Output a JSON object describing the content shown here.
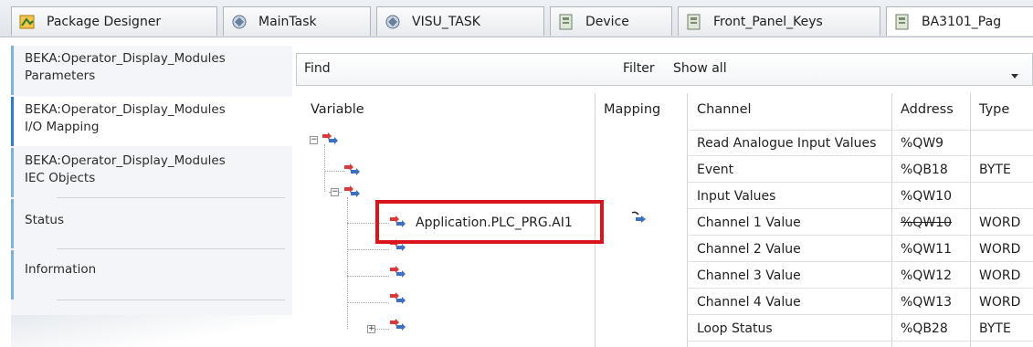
{
  "tabs": [
    {
      "label": "Package Designer",
      "icon": "package-icon"
    },
    {
      "label": "MainTask",
      "icon": "task-icon"
    },
    {
      "label": "VISU_TASK",
      "icon": "task-icon"
    },
    {
      "label": "Device",
      "icon": "device-icon"
    },
    {
      "label": "Front_Panel_Keys",
      "icon": "device-icon"
    },
    {
      "label": "BA3101_Pag",
      "icon": "device-icon"
    }
  ],
  "nav": {
    "items": [
      {
        "line1": "BEKA:Operator_Display_Modules",
        "line2": "Parameters"
      },
      {
        "line1": "BEKA:Operator_Display_Modules",
        "line2": "I/O Mapping"
      },
      {
        "line1": "BEKA:Operator_Display_Modules",
        "line2": "IEC Objects"
      },
      {
        "line1": "Status",
        "line2": ""
      },
      {
        "line1": "Information",
        "line2": ""
      }
    ],
    "active_index": 1
  },
  "findbar": {
    "find_label": "Find",
    "find_value": "",
    "filter_label": "Filter",
    "filter_value": "Show all"
  },
  "table": {
    "headers": {
      "variable": "Variable",
      "mapping": "Mapping",
      "channel": "Channel",
      "address": "Address",
      "type": "Type"
    },
    "rows": [
      {
        "variable": "",
        "channel": "Read Analogue Input Values",
        "address": "%QW9",
        "type": ""
      },
      {
        "variable": "",
        "channel": "Event",
        "address": "%QB18",
        "type": "BYTE"
      },
      {
        "variable": "",
        "channel": "Input Values",
        "address": "%QW10",
        "type": ""
      },
      {
        "variable": "Application.PLC_PRG.AI1",
        "channel": "Channel 1 Value",
        "address": "%QW10",
        "address_struck": true,
        "type": "WORD",
        "mapped": true
      },
      {
        "variable": "",
        "channel": "Channel 2 Value",
        "address": "%QW11",
        "type": "WORD"
      },
      {
        "variable": "",
        "channel": "Channel 3 Value",
        "address": "%QW12",
        "type": "WORD"
      },
      {
        "variable": "",
        "channel": "Channel 4 Value",
        "address": "%QW13",
        "type": "WORD"
      },
      {
        "variable": "",
        "channel": "Loop Status",
        "address": "%QB28",
        "type": "BYTE"
      }
    ]
  },
  "highlight_color": "#d8141c",
  "accent_color": "#2f7bd0"
}
